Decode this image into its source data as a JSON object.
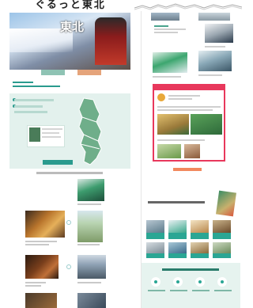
{
  "page_title": "ぐるっと東北",
  "hero": {
    "title": "東北",
    "tab_labels": [
      "",
      ""
    ]
  },
  "intro": {
    "label": "",
    "heading": ""
  },
  "section": {
    "title": ""
  },
  "right": {
    "heading": "",
    "footer_title": ""
  },
  "colors": {
    "accent_teal": "#2a9b8e",
    "accent_pink": "#e8385c",
    "accent_orange": "#f2895e"
  }
}
